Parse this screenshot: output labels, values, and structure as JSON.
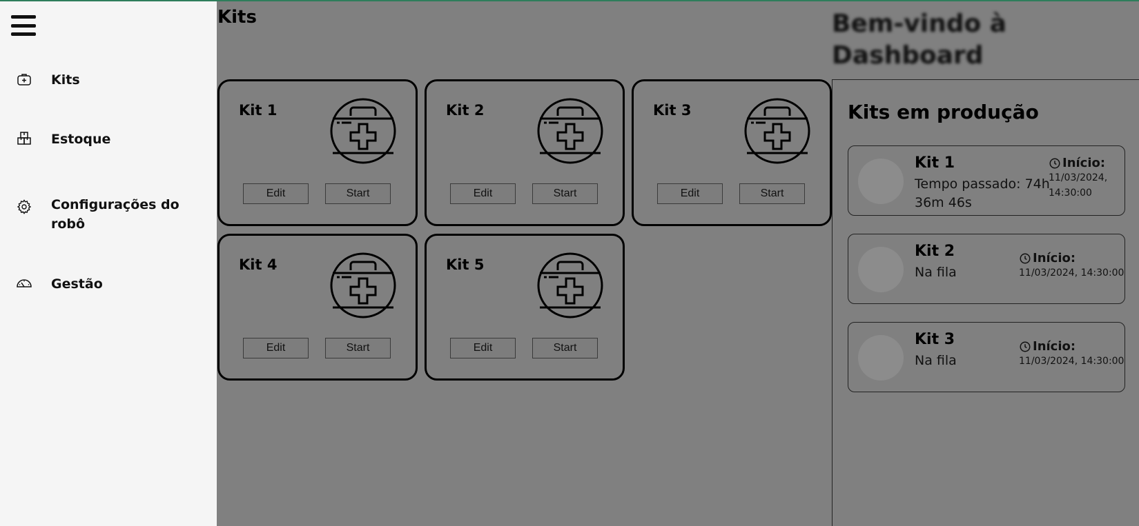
{
  "sidebar": {
    "items": [
      {
        "label": "Kits",
        "icon": "medkit-icon"
      },
      {
        "label": "Estoque",
        "icon": "boxes-icon"
      },
      {
        "label": "Configurações do robô",
        "icon": "gear-icon"
      },
      {
        "label": "Gestão",
        "icon": "gauge-icon"
      }
    ]
  },
  "main": {
    "title": "Kits",
    "kits": [
      {
        "name": "Kit 1",
        "edit_label": "Edit",
        "start_label": "Start"
      },
      {
        "name": "Kit 2",
        "edit_label": "Edit",
        "start_label": "Start"
      },
      {
        "name": "Kit 3",
        "edit_label": "Edit",
        "start_label": "Start"
      },
      {
        "name": "Kit 4",
        "edit_label": "Edit",
        "start_label": "Start"
      },
      {
        "name": "Kit 5",
        "edit_label": "Edit",
        "start_label": "Start"
      }
    ]
  },
  "welcome": "Bem-vindo à Dashboard",
  "production": {
    "title": "Kits em produção",
    "items": [
      {
        "name": "Kit 1",
        "status": "Tempo passado: 74h 36m 46s",
        "start_label": "Início:",
        "start_time": "11/03/2024, 14:30:00"
      },
      {
        "name": "Kit 2",
        "status": "Na fila",
        "start_label": "Início:",
        "start_time": "11/03/2024, 14:30:00"
      },
      {
        "name": "Kit 3",
        "status": "Na fila",
        "start_label": "Início:",
        "start_time": "11/03/2024, 14:30:00"
      }
    ]
  },
  "colors": {
    "background": "#808080",
    "sidebar": "#f5f5f5",
    "accent_top": "#2e7d5b"
  }
}
